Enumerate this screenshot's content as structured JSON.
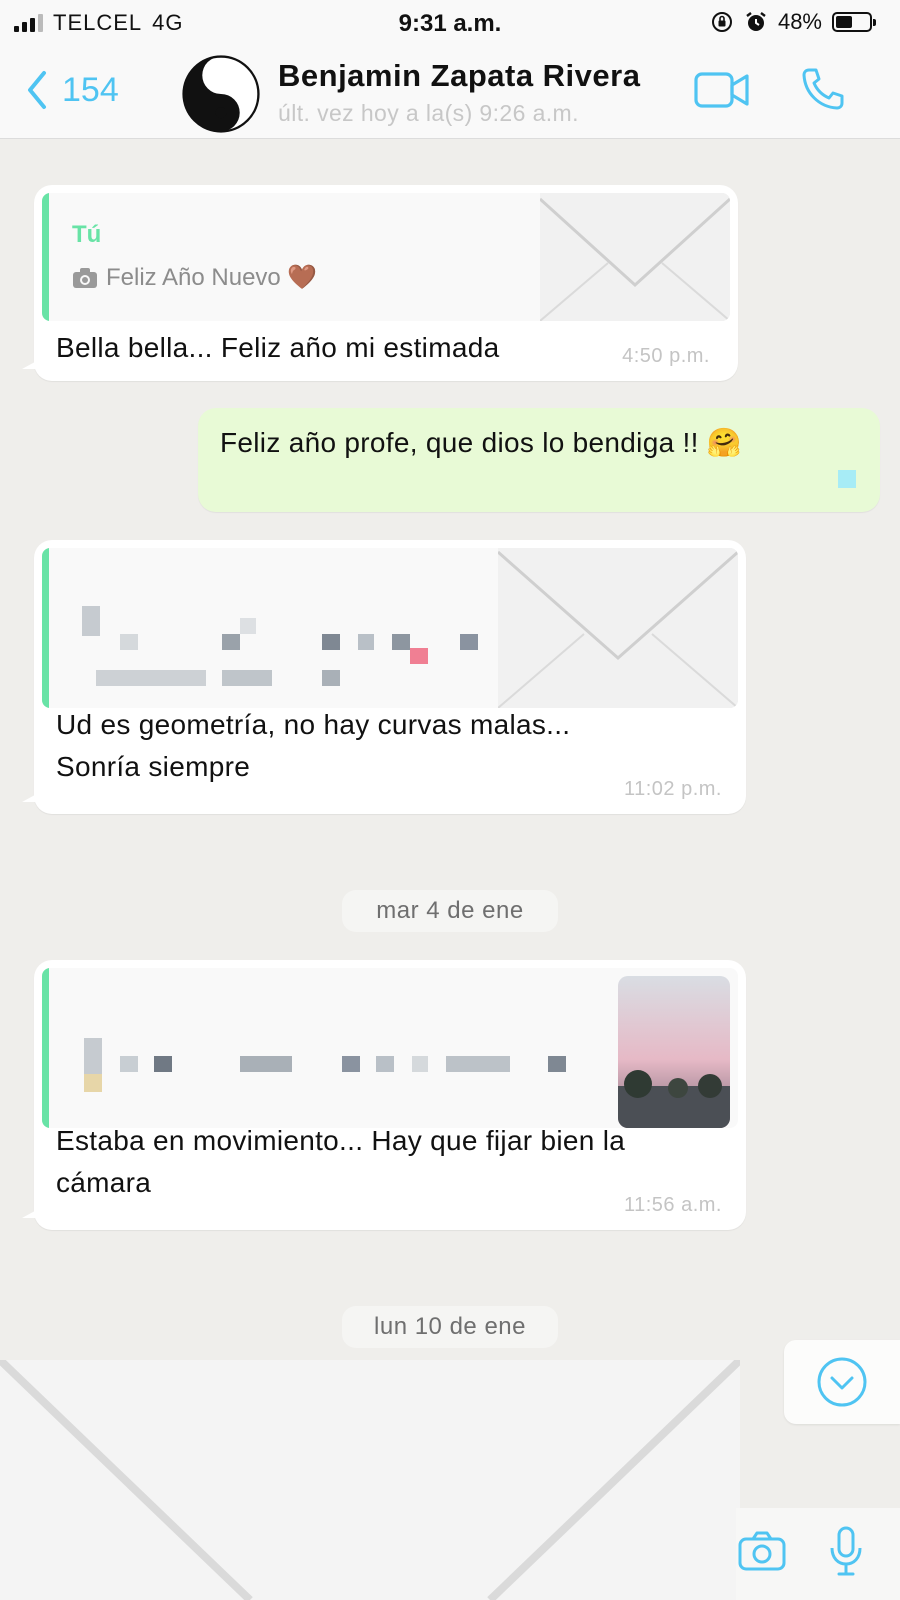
{
  "status_bar": {
    "carrier": "TELCEL",
    "network": "4G",
    "time": "9:31 a.m.",
    "battery_percent": "48%",
    "battery_level": 0.48
  },
  "header": {
    "back_count": "154",
    "contact_name": "Benjamin Zapata Rivera",
    "last_seen": "últ. vez hoy a la(s) 9:26 a.m."
  },
  "messages": [
    {
      "quote_author": "Tú",
      "quote_text": "Feliz Año Nuevo 🤎",
      "text": "Bella bella... Feliz año mi estimada",
      "time": "4:50 p.m."
    },
    {
      "text": "Feliz año profe, que dios lo bendiga !! 🤗"
    },
    {
      "text_line1": "Ud es geometría, no hay curvas malas...",
      "text_line2": "Sonría siempre",
      "time": "11:02 p.m."
    },
    {
      "text_line1": "Estaba en movimiento... Hay que fijar bien la",
      "text_line2": "cámara",
      "time": "11:56 a.m."
    }
  ],
  "date_separators": [
    "mar 4 de ene",
    "lun 10 de ene"
  ],
  "colors": {
    "accent": "#4fc4f2",
    "quote_bar": "#68e3a6",
    "outgoing_bubble": "#e8fad6",
    "background": "#efeeeb"
  },
  "icons": {
    "back": "chevron-left-icon",
    "video": "video-camera-icon",
    "call": "phone-icon",
    "camera": "camera-icon",
    "mic": "microphone-icon",
    "scroll_down": "chevron-down-circle-icon"
  }
}
